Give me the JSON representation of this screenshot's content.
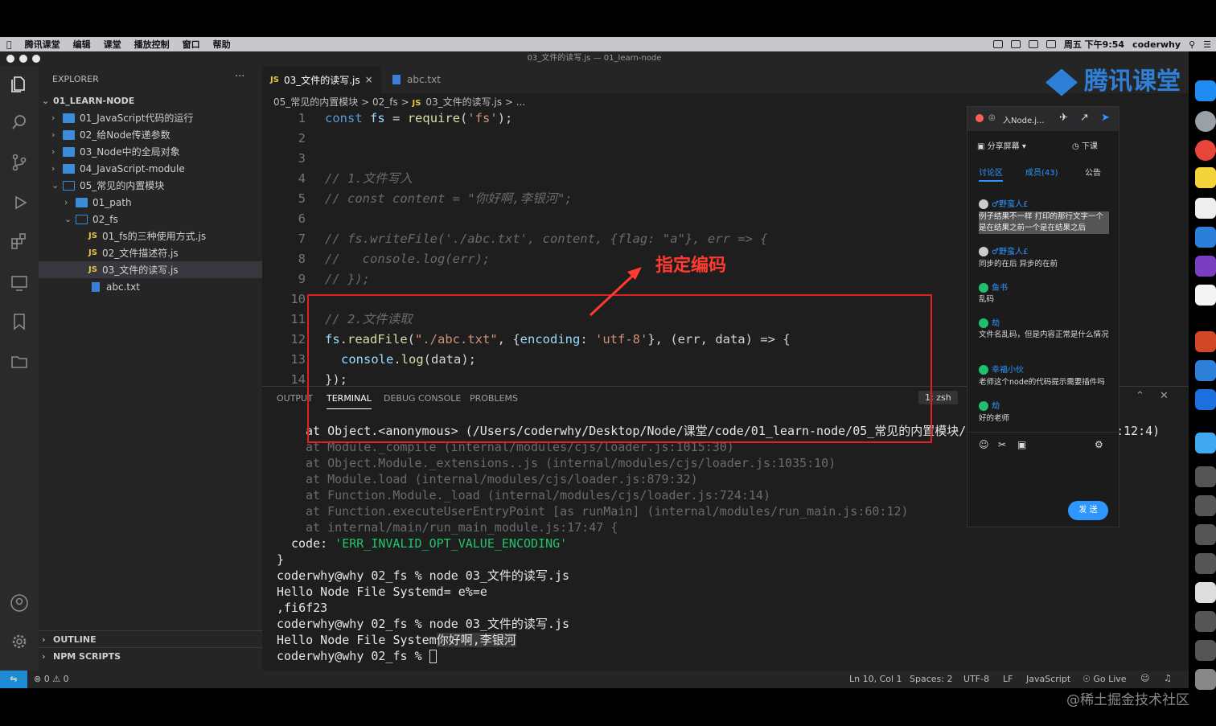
{
  "menubar": {
    "items": [
      "腾讯课堂",
      "编辑",
      "课堂",
      "播放控制",
      "窗口",
      "帮助"
    ],
    "datetime": "周五 下午9:54",
    "user": "coderwhy"
  },
  "window": {
    "title": "03_文件的读写.js — 01_learn-node"
  },
  "sidebar": {
    "header": "EXPLORER",
    "more": "···",
    "root": "01_LEARN-NODE",
    "items": [
      {
        "label": "01_JavaScript代码的运行"
      },
      {
        "label": "02_给Node传递参数"
      },
      {
        "label": "03_Node中的全局对象"
      },
      {
        "label": "04_JavaScript-module"
      },
      {
        "label": "05_常见的内置模块"
      },
      {
        "label": "01_path"
      },
      {
        "label": "02_fs"
      },
      {
        "label": "01_fs的三种使用方式.js"
      },
      {
        "label": "02_文件描述符.js"
      },
      {
        "label": "03_文件的读写.js"
      },
      {
        "label": "abc.txt"
      }
    ],
    "outline": "OUTLINE",
    "npm_scripts": "NPM SCRIPTS",
    "js_badge": "JS"
  },
  "tabs": [
    {
      "label": "03_文件的读写.js",
      "close": "×"
    },
    {
      "label": "abc.txt"
    }
  ],
  "breadcrumb": [
    "05_常见的内置模块",
    "02_fs",
    "03_文件的读写.js",
    "..."
  ],
  "breadcrumb_sep": ">",
  "code": {
    "line_numbers": [
      "1",
      "2",
      "3",
      "4",
      "5",
      "6",
      "7",
      "8",
      "9",
      "10",
      "11",
      "12",
      "13",
      "14"
    ],
    "l1": {
      "kw": "const",
      "id": "fs",
      "op": "=",
      "fn": "require",
      "p1": "(",
      "str": "'fs'",
      "p2": ");"
    },
    "l4": "// 1.文件写入",
    "l5": "// const content = \"你好啊,李银河\";",
    "l7": "// fs.writeFile('./abc.txt', content, {flag: \"a\"}, err => {",
    "l8": "//   console.log(err);",
    "l9": "// });",
    "l11": "// 2.文件读取",
    "l12": {
      "obj": "fs",
      "dot": ".",
      "fn": "readFile",
      "p1": "(",
      "str1": "\"./abc.txt\"",
      "c1": ", {",
      "key": "encoding",
      "colon": ": ",
      "str2": "'utf-8'",
      "rest": "}, (err, data) => {"
    },
    "l13": {
      "obj": "console",
      "dot": ".",
      "fn": "log",
      "rest": "(data);"
    },
    "l14": "});"
  },
  "annotation": "指定编码",
  "panel": {
    "tabs": [
      "OUTPUT",
      "TERMINAL",
      "DEBUG CONSOLE",
      "PROBLEMS"
    ],
    "shell": "1: zsh",
    "lines": [
      "at Object.<anonymous> (/Users/coderwhy/Desktop/Node/课堂/code/01_learn-node/05_常见的内置模块/",
      "at Module._compile (internal/modules/cjs/loader.js:1015:30)",
      "at Object.Module._extensions..js (internal/modules/cjs/loader.js:1035:10)",
      "at Module.load (internal/modules/cjs/loader.js:879:32)",
      "at Function.Module._load (internal/modules/cjs/loader.js:724:14)",
      "at Function.executeUserEntryPoint [as runMain] (internal/modules/run_main.js:60:12)",
      "at internal/main/run_main_module.js:17:47 {",
      "}",
      "coderwhy@why 02_fs % node 03_文件的读写.js",
      "Hello Node File Systemd= e%=e",
      ",fi6f23",
      "coderwhy@why 02_fs % node 03_文件的读写.js",
      "Hello Node File System",
      "你好啊,李银河",
      "coderwhy@why 02_fs % "
    ],
    "line0_tail": ":12:4)",
    "code_label": "code: ",
    "code_value": "'ERR_INVALID_OPT_VALUE_ENCODING'"
  },
  "statusbar": {
    "errors": "0",
    "warnings": "0",
    "position": "Ln 10, Col 1",
    "spaces": "Spaces: 2",
    "encoding": "UTF-8",
    "eol": "LF",
    "language": "JavaScript",
    "golive": "Go Live"
  },
  "chat": {
    "title": "入Node.j...",
    "share": "分享屏幕",
    "leave": "下课",
    "tabs": [
      "讨论区",
      "成员(43)",
      "公告"
    ],
    "messages": [
      {
        "user": "♂野蛮人£",
        "text": "例子结果不一样 打印的那行文字一个是在结果之前一个是在结果之后"
      },
      {
        "user": "♂野蛮人£",
        "text": "同步的在后 异步的在前"
      },
      {
        "user": "鱼书",
        "text": "乱码"
      },
      {
        "user": "劫",
        "text": "文件名乱码，但是内容正常是什么情况"
      },
      {
        "user": "幸福小伙",
        "text": "老师这个node的代码提示需要插件吗"
      },
      {
        "user": "劫",
        "text": "好的老师"
      }
    ],
    "send": "发 送"
  },
  "brand": "腾讯课堂",
  "watermark": "@稀土掘金技术社区",
  "colors": {
    "accent": "#2f96ff",
    "annotation": "#e02020",
    "statusbar_remote": "#1f8ad2"
  }
}
